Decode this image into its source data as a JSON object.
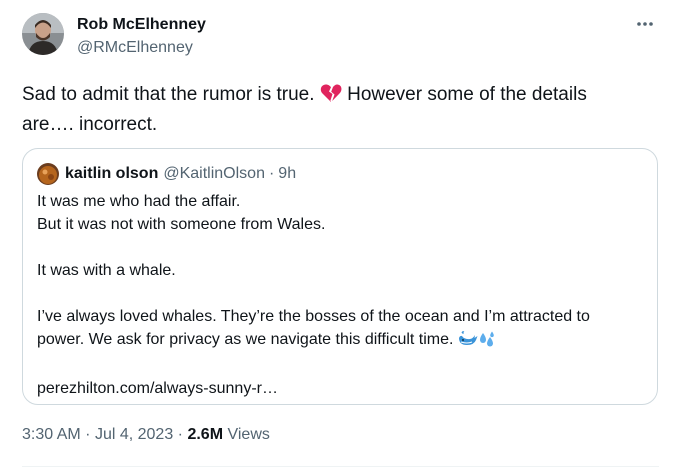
{
  "author": {
    "display_name": "Rob McElhenney",
    "handle": "@RMcElhenney"
  },
  "tweet": {
    "text_before_emoji": "Sad to admit that the rumor is true. ",
    "emoji_icon": "broken-heart-icon",
    "text_after_emoji": " However some of the details are…. incorrect."
  },
  "quote": {
    "display_name": "kaitlin olson",
    "handle": "@KaitlinOlson",
    "separator": "·",
    "time": "9h",
    "lines": [
      "It was me who had the affair.",
      "But it was not with someone from Wales.",
      "",
      "It was with a whale.",
      "",
      "I’ve always loved whales. They’re the bosses of the ocean and I’m attracted to",
      "power. We ask for privacy as we navigate this difficult time.",
      "",
      "perezhilton.com/always-sunny-r…"
    ],
    "emoji_icons": [
      "whale-icon",
      "sweat-droplets-icon"
    ]
  },
  "footer": {
    "time": "3:30 AM",
    "separator1": "·",
    "date": "Jul 4, 2023",
    "separator2": "·",
    "views_count": "2.6M",
    "views_label": "Views"
  },
  "colors": {
    "text_primary": "#0f1419",
    "text_secondary": "#536471",
    "border": "#cfd9de",
    "heart": "#e0245e",
    "whale": "#3b94d9"
  }
}
